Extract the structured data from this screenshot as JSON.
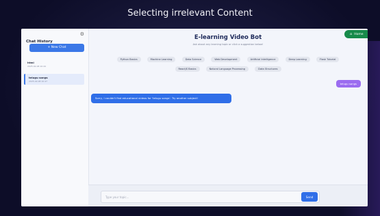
{
  "video": {
    "title": "Selecting irrelevant Content"
  },
  "sidebar": {
    "title": "Chat History",
    "new_chat_label": "+ New Chat",
    "chats": [
      {
        "title": "html",
        "date": "2025-02-08 10:44"
      },
      {
        "title": "telugu songs",
        "date": "2025-02-08 10:47"
      }
    ]
  },
  "header": {
    "home_label": "Home",
    "title": "E-learning Video Bot",
    "subtitle": "Ask about any learning topic or click a suggestion below!"
  },
  "suggestions": [
    "Python Basics",
    "Machine Learning",
    "Data Science",
    "Web Development",
    "Artificial Intelligence",
    "Deep Learning",
    "Flask Tutorial",
    "ReactJS Basics",
    "Natural Language Processing",
    "Data Structures"
  ],
  "conversation": {
    "user_message": "telugu songs",
    "bot_message": "Sorry, I couldn't find educational videos for 'telugu songs'. Try another subject!"
  },
  "composer": {
    "placeholder": "Type your topic...",
    "send_label": "Send"
  },
  "colors": {
    "primary": "#2f6ee8",
    "user_bubble": "#9b6cf0",
    "home": "#178a4a",
    "title": "#1e2a5a"
  }
}
